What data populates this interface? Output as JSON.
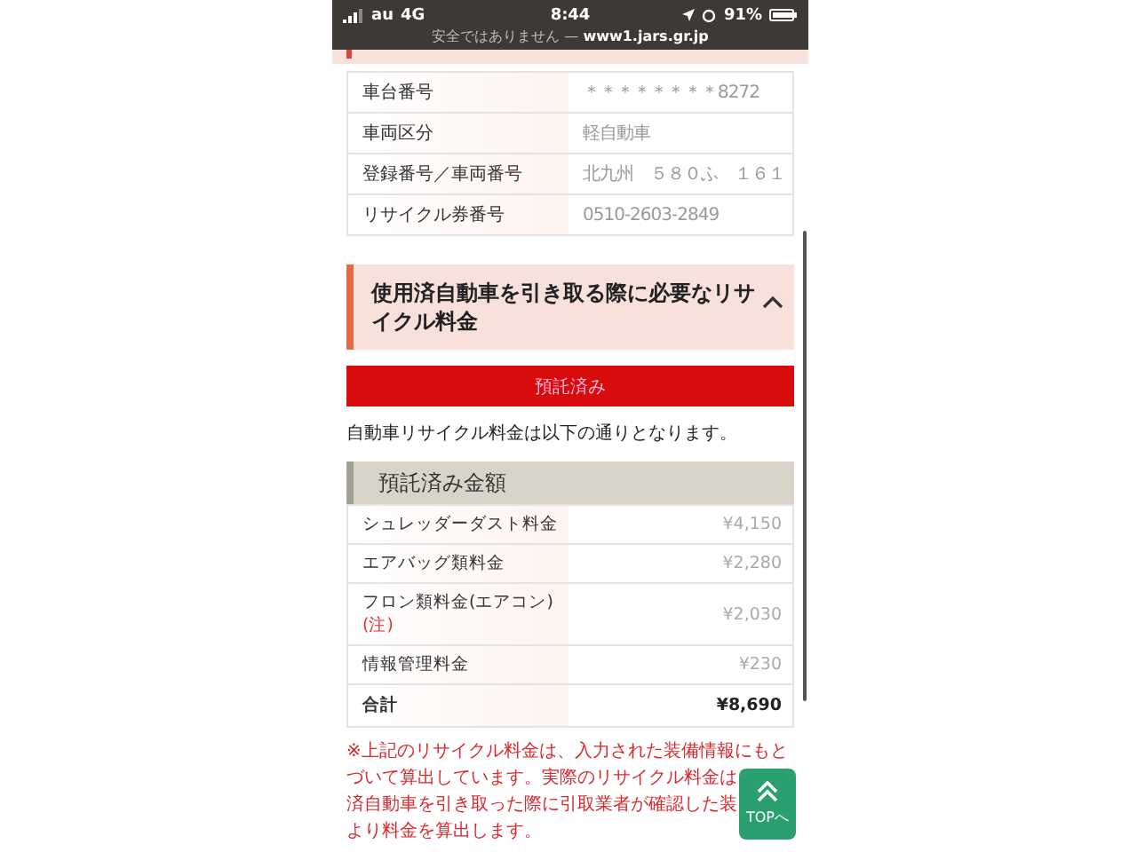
{
  "status_bar": {
    "carrier": "au",
    "network": "4G",
    "time": "8:44",
    "battery": "91%",
    "url": "安全ではありません — **www1.jars.gr.jp**"
  },
  "vehicle_table": [
    {
      "label": "車台番号",
      "value": "＊＊＊＊＊＊＊＊8272"
    },
    {
      "label": "車両区分",
      "value": "軽自動車"
    },
    {
      "label": "登録番号／車両番号",
      "value": "北九州　５８０ふ　１６１"
    },
    {
      "label": "リサイクル券番号",
      "value": "0510-2603-2849"
    }
  ],
  "section": {
    "title": "使用済自動車を引き取る際に必要なリサイクル料金",
    "expanded": true
  },
  "status_button": "預託済み",
  "intro": "自動車リサイクル料金は以下の通りとなります。",
  "fees": {
    "title": "預託済み金額",
    "rows": [
      {
        "kind": "item",
        "label": "シュレッダーダスト料金",
        "value": "¥4,150"
      },
      {
        "kind": "item",
        "label": "エアバッグ類料金",
        "value": "¥2,280"
      },
      {
        "kind": "item",
        "label": "フロン類料金(エアコン)",
        "note": "(注)",
        "value": "¥2,030"
      },
      {
        "kind": "item",
        "label": "情報管理料金",
        "value": "¥230"
      },
      {
        "kind": "total",
        "label": "合計",
        "value": "¥8,690"
      }
    ]
  },
  "note_lines": [
    "※上記のリサイクル料金は、入力された装備情報にもと",
    "づいて算出しています。実際のリサイクル料金は",
    "済自動車を引き取った際に引取業者が確認した装",
    "より料金を算出します。"
  ],
  "top_button": "TOPへ"
}
